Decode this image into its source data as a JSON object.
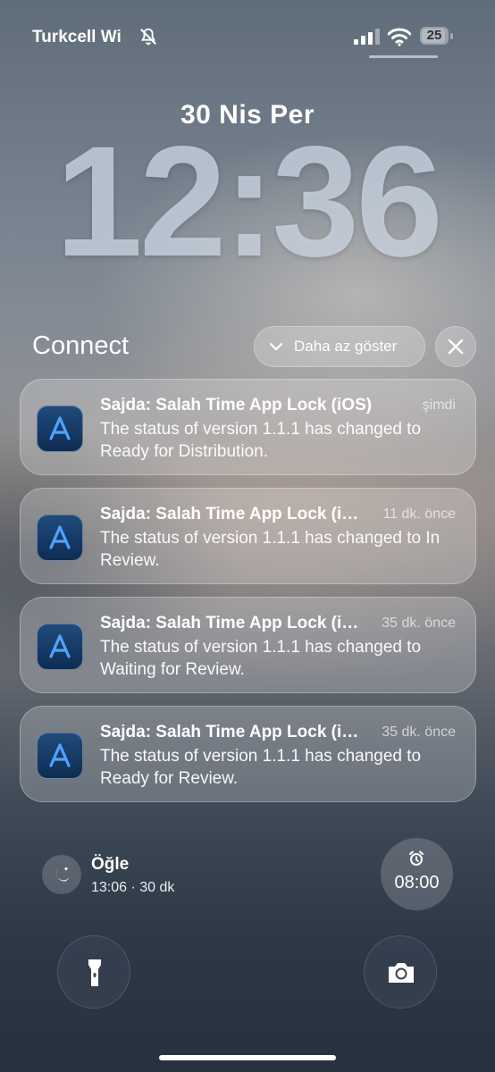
{
  "status_bar": {
    "carrier": "Turkcell Wi",
    "battery_level": "25"
  },
  "lock_screen": {
    "date": "30 Nis Per",
    "time": "12:36"
  },
  "notification_group": {
    "title": "Connect",
    "show_less_label": "Daha az göster",
    "notifications": [
      {
        "title": "Sajda: Salah Time App Lock (iOS)",
        "time": "şimdi",
        "body": "The status of version 1.1.1 has changed to Ready for Distribution."
      },
      {
        "title": "Sajda: Salah Time App Lock (iOS)",
        "time": "11 dk. önce",
        "body": "The status of version 1.1.1 has changed to In Review."
      },
      {
        "title": "Sajda: Salah Time App Lock (iOS)",
        "time": "35 dk. önce",
        "body": "The status of version 1.1.1 has changed to Waiting for Review."
      },
      {
        "title": "Sajda: Salah Time App Lock (iOS)",
        "time": "35 dk. önce",
        "body": "The status of version 1.1.1 has changed to Ready for Review."
      }
    ]
  },
  "widgets": {
    "prayer": {
      "title": "Öğle",
      "subtitle": "13:06 · 30 dk"
    },
    "alarm": {
      "time": "08:00"
    }
  },
  "icons": {
    "notification_app": "app-store-connect-icon",
    "prayer": "moon-stars-icon",
    "alarm": "alarm-clock-icon",
    "flashlight": "flashlight-icon",
    "camera": "camera-icon"
  }
}
